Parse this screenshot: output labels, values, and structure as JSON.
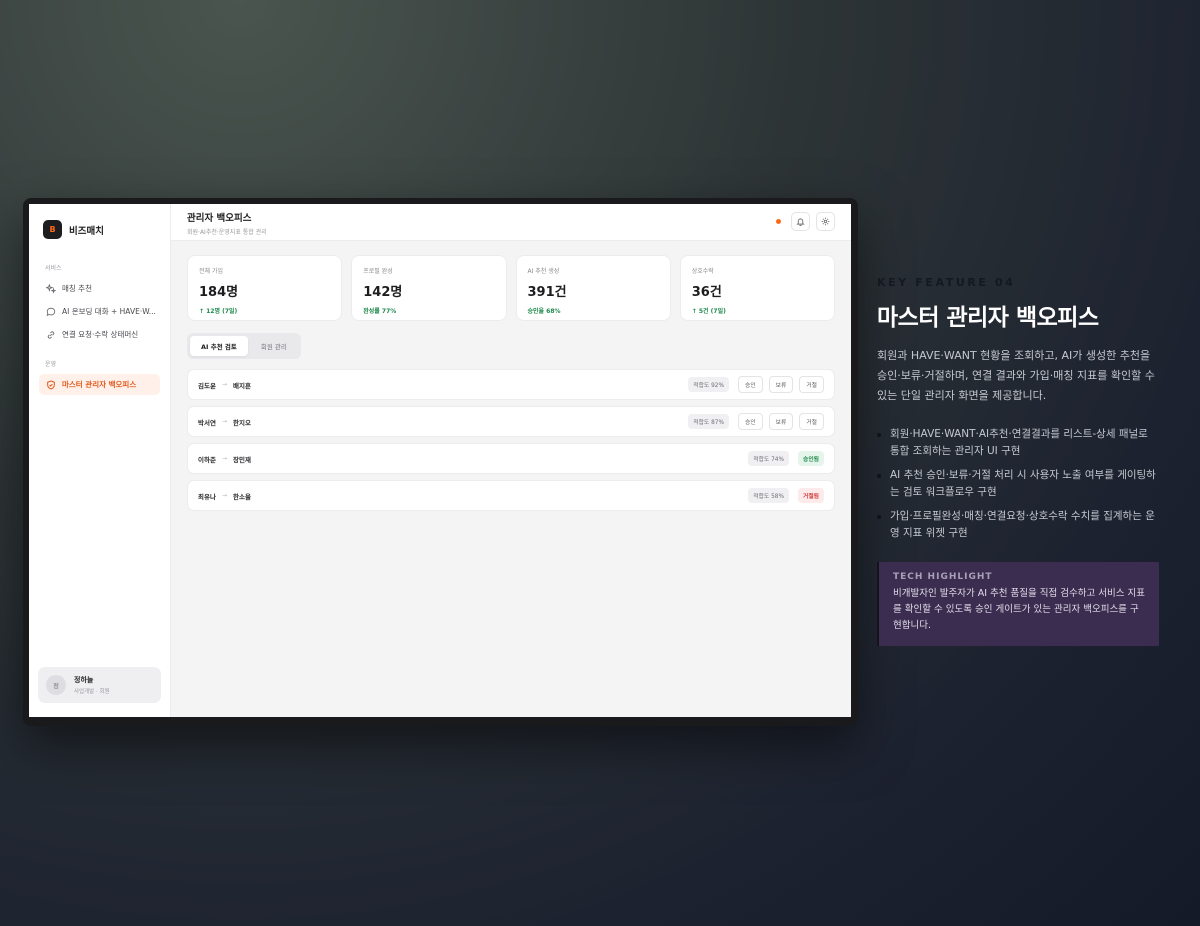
{
  "app": {
    "brand_letter": "B",
    "brand_name": "비즈매치"
  },
  "sidebar": {
    "section_service": "서비스",
    "section_ops": "운영",
    "items": [
      {
        "label": "매칭 추천",
        "icon": "sparkle-icon"
      },
      {
        "label": "AI 온보딩 대화 + HAVE·W...",
        "icon": "chat-icon"
      },
      {
        "label": "연결 요청·수락 상태머신",
        "icon": "link-icon"
      },
      {
        "label": "마스터 관리자 백오피스",
        "icon": "shield-icon",
        "active": true
      }
    ],
    "user": {
      "avatar": "정",
      "name": "정하늘",
      "role": "사업개발 · 회원"
    }
  },
  "header": {
    "title": "관리자 백오피스",
    "subtitle": "회원·AI추천·운영지표 통합 관리"
  },
  "stats": [
    {
      "label": "전체 가입",
      "value": "184명",
      "delta": "↑ 12명 (7일)"
    },
    {
      "label": "프로필 완성",
      "value": "142명",
      "delta": "완성률 77%"
    },
    {
      "label": "AI 추천 생성",
      "value": "391건",
      "delta": "승인율 68%"
    },
    {
      "label": "상호수락",
      "value": "36건",
      "delta": "↑ 5건 (7일)"
    }
  ],
  "tabs": {
    "ai_review": "AI 추천 검토",
    "members": "회원 관리"
  },
  "recommendations": [
    {
      "from": "김도윤",
      "to": "배지훈",
      "score": "적합도 92%",
      "approve": "승인",
      "hold": "보류",
      "reject": "거절"
    },
    {
      "from": "박서연",
      "to": "한지오",
      "score": "적합도 87%",
      "approve": "승인",
      "hold": "보류",
      "reject": "거절"
    },
    {
      "from": "이하준",
      "to": "장민재",
      "score": "적합도 74%",
      "status": "승인됨"
    },
    {
      "from": "최유나",
      "to": "한소율",
      "score": "적합도 58%",
      "status": "거절됨"
    }
  ],
  "feature": {
    "kicker": "KEY FEATURE 04",
    "title": "마스터 관리자 백오피스",
    "description": "회원과 HAVE·WANT 현황을 조회하고, AI가 생성한 추천을 승인·보류·거절하며, 연결 결과와 가입·매칭 지표를 확인할 수 있는 단일 관리자 화면을 제공합니다.",
    "bullets": [
      "회원·HAVE·WANT·AI추천·연결결과를 리스트-상세 패널로 통합 조회하는 관리자 UI 구현",
      "AI 추천 승인·보류·거절 처리 시 사용자 노출 여부를 게이팅하는 검토 워크플로우 구현",
      "가입·프로필완성·매칭·연결요청·상호수락 수치를 집계하는 운영 지표 위젯 구현"
    ],
    "tech_title": "TECH HIGHLIGHT",
    "tech_text": "비개발자인 발주자가 AI 추천 품질을 직접 검수하고 서비스 지표를 확인할 수 있도록 승인 게이트가 있는 관리자 백오피스를 구현합니다."
  },
  "colors": {
    "accent": "#ff6a1a",
    "positive": "#1f8a4c",
    "negative": "#d23c3c",
    "tech_panel": "#3a2d4f"
  }
}
